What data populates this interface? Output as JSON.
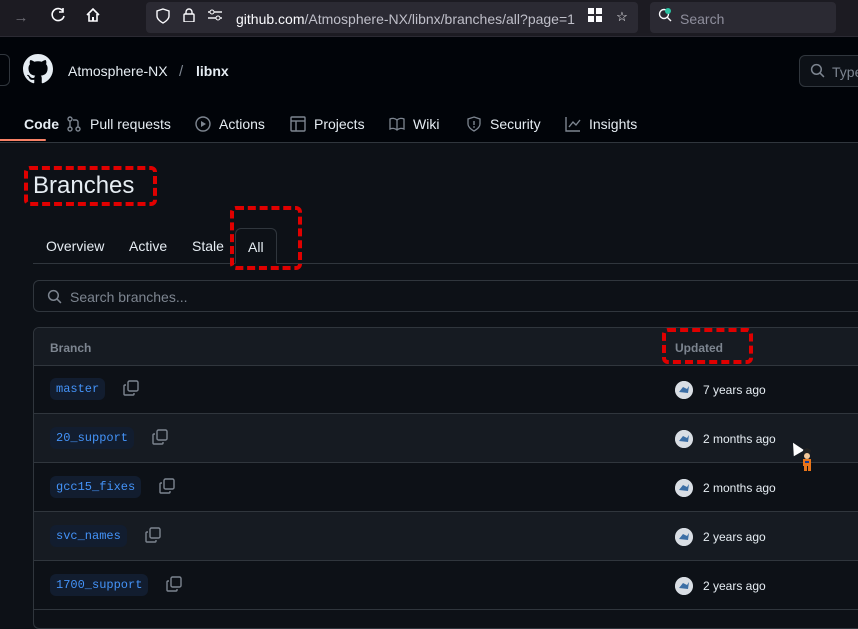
{
  "browser": {
    "url_host": "github.com",
    "url_path": "/Atmosphere-NX/libnx/branches/all?page=1",
    "search_placeholder": "Search"
  },
  "header": {
    "owner": "Atmosphere-NX",
    "separator": "/",
    "repo": "libnx",
    "search_placeholder": "Type"
  },
  "repo_nav": {
    "items": [
      {
        "label": "Code",
        "icon": "code-icon",
        "selected": true
      },
      {
        "label": "Pull requests",
        "icon": "pull-request-icon"
      },
      {
        "label": "Actions",
        "icon": "play-icon"
      },
      {
        "label": "Projects",
        "icon": "table-icon"
      },
      {
        "label": "Wiki",
        "icon": "book-icon"
      },
      {
        "label": "Security",
        "icon": "shield-icon"
      },
      {
        "label": "Insights",
        "icon": "graph-icon"
      }
    ]
  },
  "page": {
    "title": "Branches",
    "tabs": [
      {
        "label": "Overview"
      },
      {
        "label": "Active"
      },
      {
        "label": "Stale"
      },
      {
        "label": "All",
        "active": true
      }
    ],
    "search_placeholder": "Search branches..."
  },
  "table": {
    "columns": {
      "branch": "Branch",
      "updated": "Updated"
    },
    "rows": [
      {
        "branch": "master",
        "updated": "7 years ago"
      },
      {
        "branch": "20_support",
        "updated": "2 months ago"
      },
      {
        "branch": "gcc15_fixes",
        "updated": "2 months ago"
      },
      {
        "branch": "svc_names",
        "updated": "2 years ago"
      },
      {
        "branch": "1700_support",
        "updated": "2 years ago"
      }
    ]
  },
  "colors": {
    "accent_link": "#4493f8",
    "annotation_red": "#e00000",
    "nav_underline": "#f78166"
  }
}
